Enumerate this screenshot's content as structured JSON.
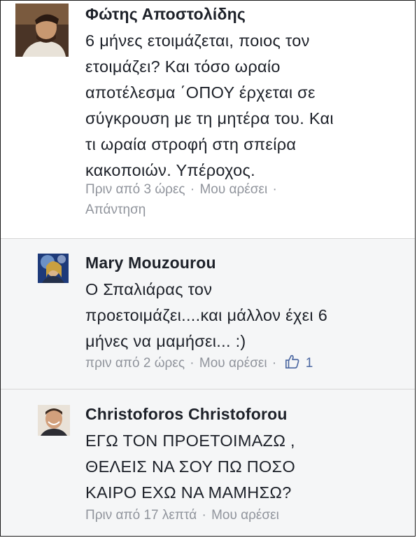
{
  "comments": [
    {
      "author": "Φώτης Αποστολίδης",
      "text_lines": [
        "6 μήνες ετοιμάζεται, ποιος τον",
        "ετοιμάζει? Και τόσο ωραίο",
        "αποτέλεσμα ΄ΟΠΟΥ έρχεται σε",
        "σύγκρουση με τη μητέρα του. Και",
        "τι ωραία στροφή στη σπείρα",
        "κακοποιών. Υπέροχος."
      ],
      "time": "Πριν από 3 ώρες",
      "like_label": "Μου αρέσει",
      "reply_label": "Απάντηση"
    },
    {
      "author": "Mary Mouzourou",
      "text_lines": [
        "Ο Σπαλιάρας τον",
        "προετοιμάζει....και μάλλον έχει 6",
        "μήνες να μαμήσει... :)"
      ],
      "time": "πριν από 2 ώρες",
      "like_label": "Μου αρέσει",
      "like_count": "1"
    },
    {
      "author": "Christoforos Christoforou",
      "text_lines": [
        "ΕΓΩ ΤΟΝ ΠΡΟΕΤΟΙΜΑΖΩ ,",
        "ΘΕΛΕΙΣ ΝΑ ΣΟΥ ΠΩ ΠΟΣΟ",
        "ΚΑΙΡΟ ΕΧΩ ΝΑ ΜΑΜΗΣΩ?"
      ],
      "time": "Πριν από 17 λεπτά",
      "like_label": "Μου αρέσει"
    }
  ],
  "separator": "·",
  "colors": {
    "name": "#1d2129",
    "meta": "#90949c",
    "like_count": "#4b67a1",
    "reply_background": "#f5f6f7"
  }
}
